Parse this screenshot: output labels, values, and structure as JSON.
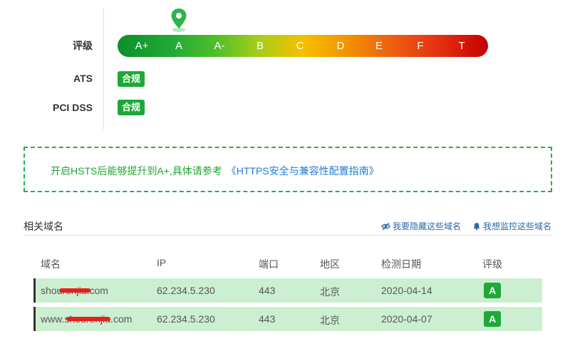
{
  "labels": {
    "grade": "评级",
    "ats": "ATS",
    "pci": "PCI DSS"
  },
  "grades": [
    "A+",
    "A",
    "A-",
    "B",
    "C",
    "D",
    "E",
    "F",
    "T"
  ],
  "current_grade": "A",
  "badges": {
    "ats": "合规",
    "pci": "合规"
  },
  "tip": {
    "text": "开启HSTS后能够提升到A+,具体请参考",
    "link": "《HTTPS安全与兼容性配置指南》"
  },
  "related": {
    "title": "相关域名",
    "hide_action": "我要隐藏这些域名",
    "watch_action": "我想监控这些域名"
  },
  "table": {
    "headers": [
      "域名",
      "IP",
      "端口",
      "地区",
      "检测日期",
      "评级"
    ],
    "rows": [
      {
        "domain": "shourenjia.com",
        "ip": "62.234.5.230",
        "port": "443",
        "region": "北京",
        "date": "2020-04-14",
        "grade": "A"
      },
      {
        "domain": "www.shourenjia.com",
        "ip": "62.234.5.230",
        "port": "443",
        "region": "北京",
        "date": "2020-04-07",
        "grade": "A"
      }
    ]
  },
  "colors": {
    "accent_green": "#1ea838",
    "link_blue": "#1d7bd7",
    "row_bg": "#ccefd1"
  }
}
